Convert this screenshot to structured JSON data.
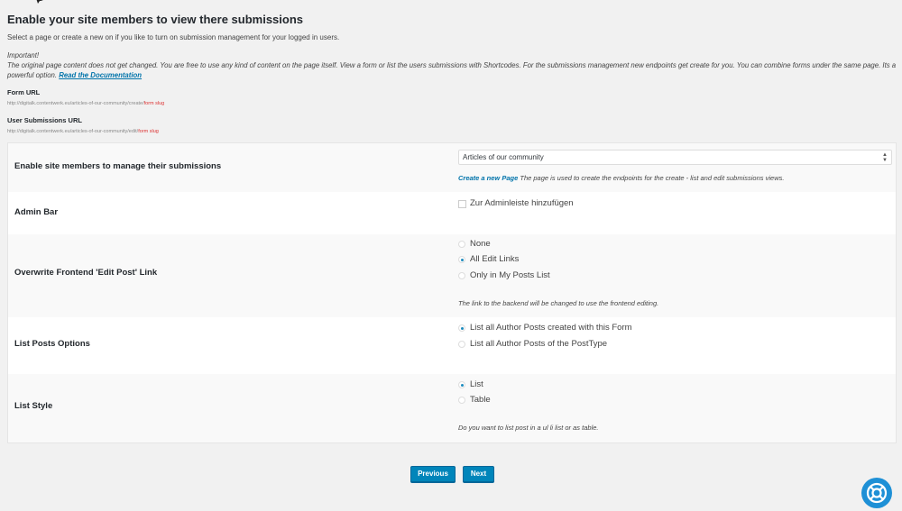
{
  "header": {
    "title": "Enable your site members to view there submissions",
    "intro": "Select a page or create a new on if you like to turn on submission management for your logged in users.",
    "important_title": "Important!",
    "important_text": "The original page content does not get changed. You are free to use any kind of content on the page itself. View a form or list the users submissions with Shortcodes. For the submissions management new endpoints get create for you. You can combine forms under the same page. Its a powerful option.",
    "doc_link": "Read the Documentation"
  },
  "urls": {
    "form_url_label": "Form URL",
    "form_url_base": "http://digitalk.contentwerk.eu/articles-of-our-community/create/",
    "form_url_slug": "form slug",
    "user_url_label": "User Submissions URL",
    "user_url_base": "http://digitalk.contentwerk.eu/articles-of-our-community/edit/",
    "user_url_slug": "form slug"
  },
  "settings": {
    "manage": {
      "label": "Enable site members to manage their submissions",
      "select_value": "Articles of our community",
      "create_link": "Create a new Page",
      "desc": "The page is used to create the endpoints for the create - list and edit submissions views."
    },
    "admin_bar": {
      "label": "Admin Bar",
      "checkbox_label": "Zur Adminleiste hinzufügen"
    },
    "edit_link": {
      "label": "Overwrite Frontend 'Edit Post' Link",
      "options": [
        "None",
        "All Edit Links",
        "Only in My Posts List"
      ],
      "selected": "All Edit Links",
      "desc": "The link to the backend will be changed to use the frontend editing."
    },
    "list_posts": {
      "label": "List Posts Options",
      "options": [
        "List all Author Posts created with this Form",
        "List all Author Posts of the PostType"
      ],
      "selected": "List all Author Posts created with this Form"
    },
    "list_style": {
      "label": "List Style",
      "options": [
        "List",
        "Table"
      ],
      "selected": "List",
      "desc": "Do you want to list post in a ul li list or as table."
    }
  },
  "nav": {
    "previous": "Previous",
    "next": "Next"
  },
  "colors": {
    "accent": "#0085ba",
    "link": "#0073aa",
    "slug": "#dc3232",
    "help_button": "#1e90d6"
  }
}
